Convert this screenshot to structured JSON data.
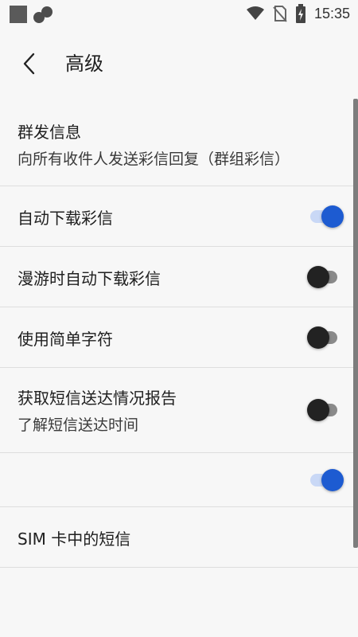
{
  "status_bar": {
    "time": "15:35"
  },
  "header": {
    "title": "高级"
  },
  "settings": [
    {
      "title": "群发信息",
      "subtitle": "向所有收件人发送彩信回复（群组彩信）"
    },
    {
      "title": "自动下载彩信",
      "toggle": "on"
    },
    {
      "title": "漫游时自动下载彩信",
      "toggle": "off"
    },
    {
      "title": "使用简单字符",
      "toggle": "off"
    },
    {
      "title": "获取短信送达情况报告",
      "subtitle": "了解短信送达时间",
      "toggle": "off"
    },
    {
      "title": "",
      "toggle": "on"
    },
    {
      "title": "SIM 卡中的短信"
    }
  ],
  "colors": {
    "accent": "#1d5bd1",
    "background": "#f7f7f7"
  }
}
